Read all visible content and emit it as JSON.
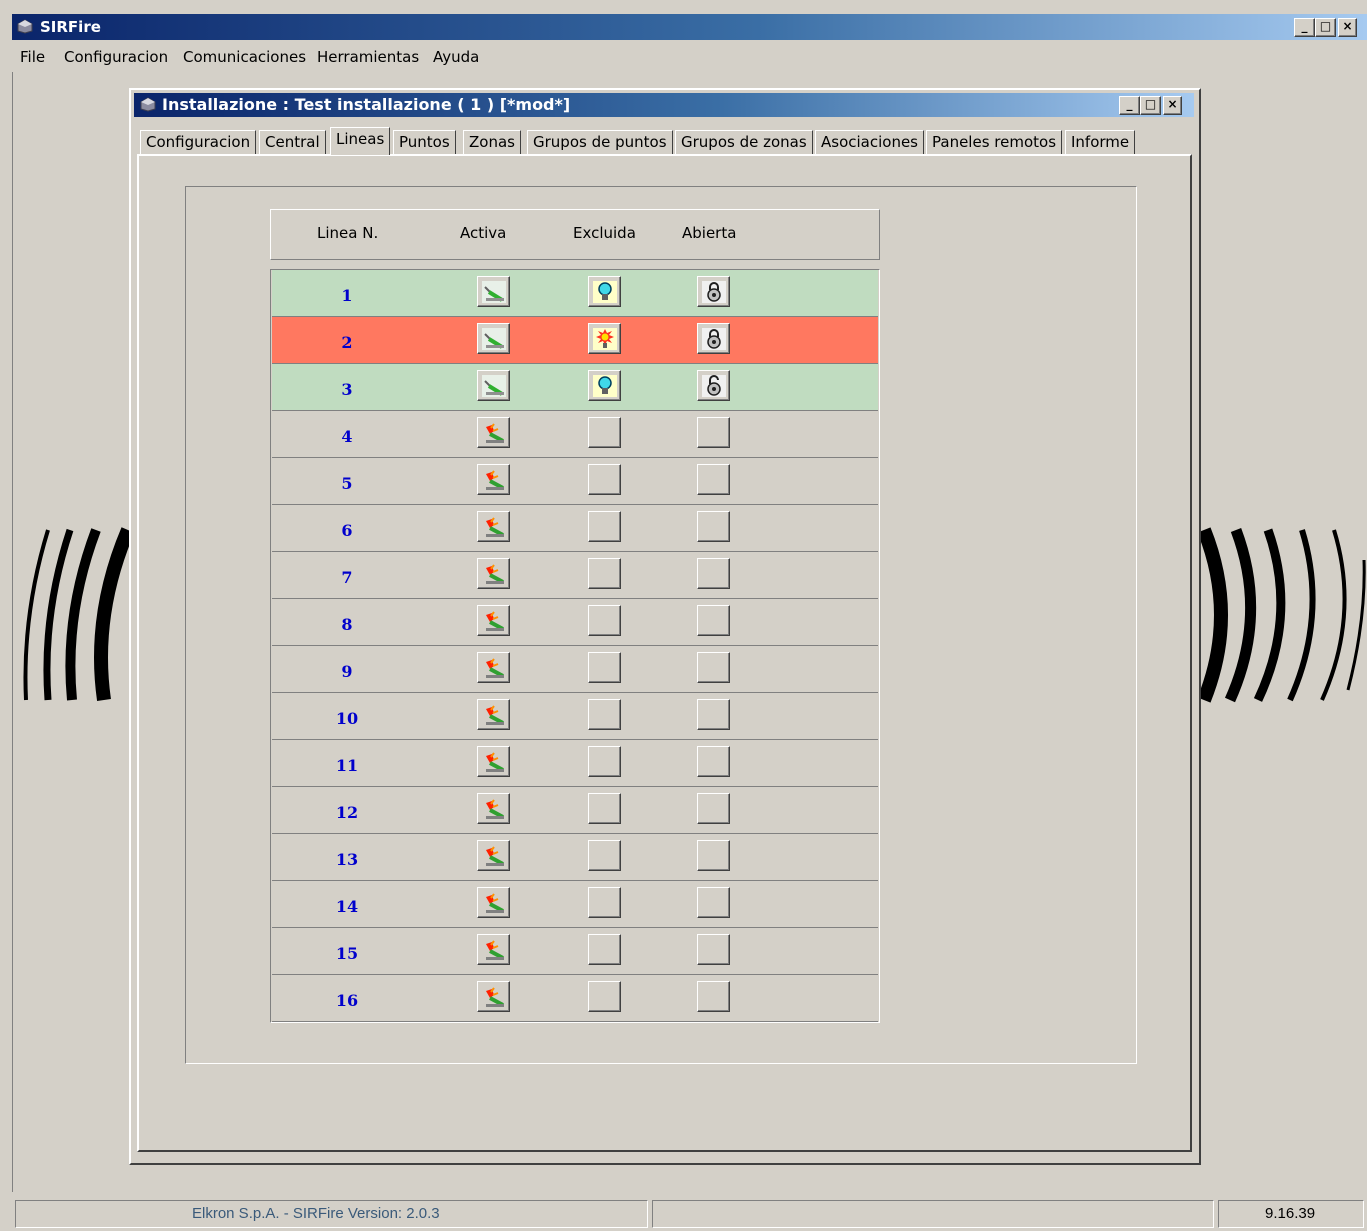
{
  "app": {
    "title": "SIRFire"
  },
  "menu": [
    {
      "label": "File"
    },
    {
      "label": "Configuracion"
    },
    {
      "label": "Comunicaciones"
    },
    {
      "label": "Herramientas"
    },
    {
      "label": "Ayuda"
    }
  ],
  "window": {
    "title": "Installazione : Test installazione  ( 1 )  [*mod*]",
    "tabs": [
      {
        "label": "Configuracion"
      },
      {
        "label": "Central"
      },
      {
        "label": "Lineas",
        "active": true
      },
      {
        "label": "Puntos"
      },
      {
        "label": "Zonas"
      },
      {
        "label": "Grupos de puntos"
      },
      {
        "label": "Grupos de zonas"
      },
      {
        "label": "Asociaciones"
      },
      {
        "label": "Paneles remotos"
      },
      {
        "label": "Informe"
      }
    ]
  },
  "table": {
    "headers": {
      "linea": "Linea N.",
      "activa": "Activa",
      "excluida": "Excluida",
      "abierta": "Abierta"
    },
    "rows": [
      {
        "num": "1",
        "status": "ok",
        "activa_icon": "plug-connected-icon",
        "excluida_icon": "bulb-blue-icon",
        "abierta_icon": "lock-icon"
      },
      {
        "num": "2",
        "status": "alarm",
        "activa_icon": "plug-connected-icon",
        "excluida_icon": "bulb-alarm-icon",
        "abierta_icon": "lock-icon"
      },
      {
        "num": "3",
        "status": "ok",
        "activa_icon": "plug-connected-icon",
        "excluida_icon": "bulb-blue-icon",
        "abierta_icon": "lock-open-icon"
      },
      {
        "num": "4",
        "status": "inactive",
        "activa_icon": "plug-disconnected-icon"
      },
      {
        "num": "5",
        "status": "inactive",
        "activa_icon": "plug-disconnected-icon"
      },
      {
        "num": "6",
        "status": "inactive",
        "activa_icon": "plug-disconnected-icon"
      },
      {
        "num": "7",
        "status": "inactive",
        "activa_icon": "plug-disconnected-icon"
      },
      {
        "num": "8",
        "status": "inactive",
        "activa_icon": "plug-disconnected-icon"
      },
      {
        "num": "9",
        "status": "inactive",
        "activa_icon": "plug-disconnected-icon"
      },
      {
        "num": "10",
        "status": "inactive",
        "activa_icon": "plug-disconnected-icon"
      },
      {
        "num": "11",
        "status": "inactive",
        "activa_icon": "plug-disconnected-icon"
      },
      {
        "num": "12",
        "status": "inactive",
        "activa_icon": "plug-disconnected-icon"
      },
      {
        "num": "13",
        "status": "inactive",
        "activa_icon": "plug-disconnected-icon"
      },
      {
        "num": "14",
        "status": "inactive",
        "activa_icon": "plug-disconnected-icon"
      },
      {
        "num": "15",
        "status": "inactive",
        "activa_icon": "plug-disconnected-icon"
      },
      {
        "num": "16",
        "status": "inactive",
        "activa_icon": "plug-disconnected-icon"
      }
    ]
  },
  "statusbar": {
    "left": "Elkron S.p.A.  -  SIRFire  Version: 2.0.3",
    "middle": "",
    "time": "9.16.39"
  },
  "colors": {
    "ok_row": "#c0dcc0",
    "alarm_row": "#ff7860",
    "inactive_row": "#d4d0c8",
    "number_text": "#0000cc"
  }
}
